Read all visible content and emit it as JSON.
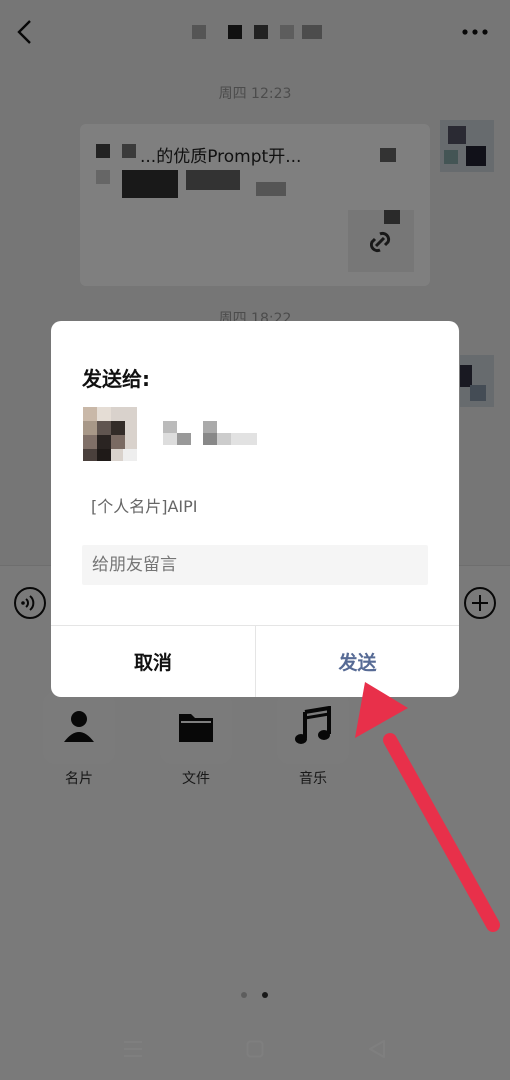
{
  "chat": {
    "timestamp_1": "周四 12:23",
    "timestamp_2": "周四 18:22",
    "card_title_fragment": "...的优质Prompt开..."
  },
  "header": {
    "back_icon": "chevron-left-icon",
    "more_icon": "more-dots-icon"
  },
  "attach_panel": {
    "items": [
      {
        "label": "名片",
        "icon": "person-icon"
      },
      {
        "label": "文件",
        "icon": "folder-icon"
      },
      {
        "label": "音乐",
        "icon": "music-note-icon"
      }
    ]
  },
  "dialog": {
    "title": "发送给:",
    "card_label": "[个人名片]AIPI",
    "message_placeholder": "给朋友留言",
    "cancel_label": "取消",
    "send_label": "发送"
  },
  "colors": {
    "accent": "#576b95",
    "arrow": "#e8304a"
  }
}
